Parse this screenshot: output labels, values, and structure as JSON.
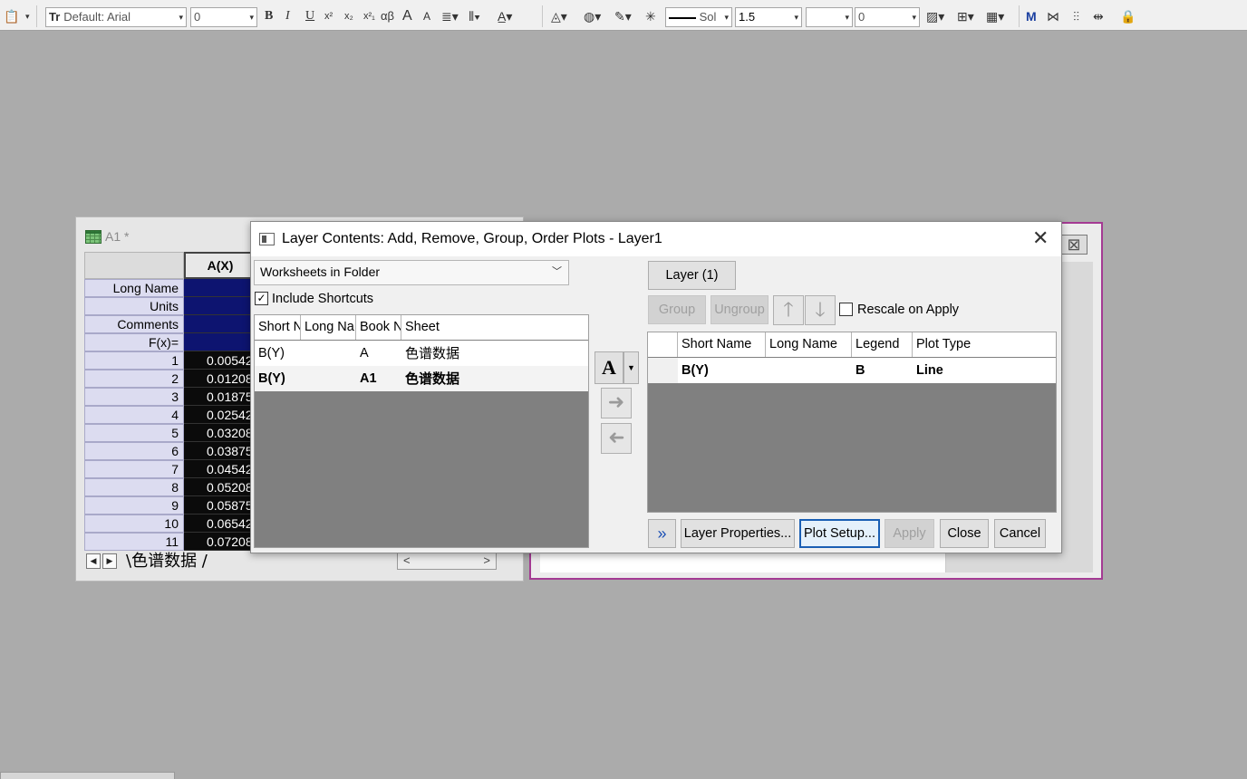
{
  "toolbar": {
    "font_name": "Default: Arial",
    "font_size": "0",
    "format_glyphs": [
      "B",
      "I",
      "U",
      "x²",
      "x₂",
      "x²₁",
      "αβ",
      "A",
      "A"
    ],
    "line_style": "Sol",
    "line_width": "1.5",
    "spacing": "0"
  },
  "worksheet": {
    "title": "A1 *",
    "column_header": "A(X)",
    "meta_rows": [
      "Long Name",
      "Units",
      "Comments",
      "F(x)="
    ],
    "rows": [
      {
        "n": "1",
        "v": "0.00542"
      },
      {
        "n": "2",
        "v": "0.01208"
      },
      {
        "n": "3",
        "v": "0.01875"
      },
      {
        "n": "4",
        "v": "0.02542"
      },
      {
        "n": "5",
        "v": "0.03208"
      },
      {
        "n": "6",
        "v": "0.03875"
      },
      {
        "n": "7",
        "v": "0.04542"
      },
      {
        "n": "8",
        "v": "0.05208"
      },
      {
        "n": "9",
        "v": "0.05875"
      },
      {
        "n": "10",
        "v": "0.06542"
      },
      {
        "n": "11",
        "v": "0.07208"
      }
    ],
    "sheet_tab": "色谱数据 /"
  },
  "dialog": {
    "title": "Layer Contents: Add, Remove, Group, Order Plots - Layer1",
    "source_combo": "Worksheets in Folder",
    "include_shortcuts_label": "Include Shortcuts",
    "include_shortcuts_checked": true,
    "left_table": {
      "headers": [
        "Short N",
        "Long Na",
        "Book N",
        "Sheet"
      ],
      "rows": [
        [
          "B(Y)",
          "",
          "A",
          "色谱数据"
        ],
        [
          "B(Y)",
          "",
          "A1",
          "色谱数据"
        ]
      ]
    },
    "layer_tab": "Layer (1)",
    "group_button": "Group",
    "ungroup_button": "Ungroup",
    "rescale_label": "Rescale on Apply",
    "rescale_checked": false,
    "right_table": {
      "headers": [
        "",
        "Short Name",
        "Long Name",
        "Legend",
        "Plot Type"
      ],
      "rows": [
        [
          "",
          "B(Y)",
          "",
          "B",
          "Line"
        ]
      ]
    },
    "buttons": {
      "expand": "»",
      "layer_properties": "Layer Properties...",
      "plot_setup": "Plot Setup...",
      "apply": "Apply",
      "close": "Close",
      "cancel": "Cancel"
    },
    "plot_type_button": "A"
  },
  "colors": {
    "desktop": "#ababab",
    "graph_border": "#a43a93",
    "meta_cell": "#0d1470",
    "focus": "#1a5fb4"
  }
}
